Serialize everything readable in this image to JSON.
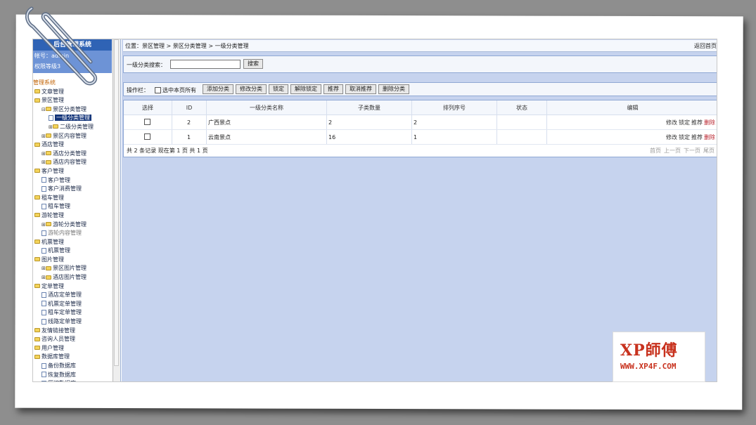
{
  "sidebar": {
    "title": "后台管理系统",
    "account_line": "帐号：admin",
    "level_line": "权限等级3",
    "tree": [
      {
        "label": "管理系统",
        "type": "root"
      },
      {
        "label": "文章管理",
        "type": "folder",
        "indent": 0
      },
      {
        "label": "景区管理",
        "type": "folder",
        "indent": 0
      },
      {
        "label": "景区分类管理",
        "type": "folder",
        "indent": 1,
        "pm": "⊟"
      },
      {
        "label": "一级分类管理",
        "type": "page",
        "indent": 2,
        "selected": true
      },
      {
        "label": "二级分类管理",
        "type": "folder",
        "indent": 2,
        "pm": "⊞"
      },
      {
        "label": "景区内容管理",
        "type": "folder",
        "indent": 1,
        "pm": "⊞"
      },
      {
        "label": "酒店管理",
        "type": "folder",
        "indent": 0
      },
      {
        "label": "酒店分类管理",
        "type": "folder",
        "indent": 1,
        "pm": "⊞"
      },
      {
        "label": "酒店内容管理",
        "type": "folder",
        "indent": 1,
        "pm": "⊞"
      },
      {
        "label": "客户管理",
        "type": "folder",
        "indent": 0
      },
      {
        "label": "客户管理",
        "type": "page",
        "indent": 1
      },
      {
        "label": "客户消费管理",
        "type": "page",
        "indent": 1
      },
      {
        "label": "租车管理",
        "type": "folder",
        "indent": 0
      },
      {
        "label": "租车管理",
        "type": "page",
        "indent": 1
      },
      {
        "label": "游轮管理",
        "type": "folder",
        "indent": 0
      },
      {
        "label": "游轮分类管理",
        "type": "folder",
        "indent": 1,
        "pm": "⊞"
      },
      {
        "label": "游轮内容管理",
        "type": "page",
        "indent": 1,
        "grey": true
      },
      {
        "label": "机票管理",
        "type": "folder",
        "indent": 0
      },
      {
        "label": "机票管理",
        "type": "page",
        "indent": 1
      },
      {
        "label": "图片管理",
        "type": "folder",
        "indent": 0
      },
      {
        "label": "景区图片管理",
        "type": "folder",
        "indent": 1,
        "pm": "⊞"
      },
      {
        "label": "酒店图片管理",
        "type": "folder",
        "indent": 1,
        "pm": "⊞"
      },
      {
        "label": "定单管理",
        "type": "folder",
        "indent": 0
      },
      {
        "label": "酒店定单管理",
        "type": "page",
        "indent": 1
      },
      {
        "label": "机票定单管理",
        "type": "page",
        "indent": 1
      },
      {
        "label": "租车定单管理",
        "type": "page",
        "indent": 1
      },
      {
        "label": "线路定单管理",
        "type": "page",
        "indent": 1
      },
      {
        "label": "友情链接管理",
        "type": "folder",
        "indent": 0
      },
      {
        "label": "咨询人员管理",
        "type": "folder",
        "indent": 0
      },
      {
        "label": "用户管理",
        "type": "folder",
        "indent": 0
      },
      {
        "label": "数据库管理",
        "type": "folder",
        "indent": 0
      },
      {
        "label": "备份数据库",
        "type": "page",
        "indent": 1
      },
      {
        "label": "恢复数据库",
        "type": "page",
        "indent": 1
      },
      {
        "label": "压缩数据库",
        "type": "page",
        "indent": 1
      }
    ]
  },
  "breadcrumb": {
    "text": "位置：景区管理 > 景区分类管理 > 一级分类管理",
    "back_label": "返回首页"
  },
  "search": {
    "label": "一级分类搜索：",
    "value": "",
    "button_label": "搜索"
  },
  "toolbar": {
    "label": "操作栏：",
    "select_all_label": "选中本页所有",
    "buttons": [
      "添加分类",
      "修改分类",
      "锁定",
      "解除锁定",
      "推荐",
      "取消推荐",
      "删除分类"
    ]
  },
  "table": {
    "headers": [
      "选择",
      "ID",
      "一级分类名称",
      "子类数量",
      "排列序号",
      "状态",
      "编辑"
    ],
    "rows": [
      {
        "id": "2",
        "name": "广西景点",
        "children": "2",
        "order": "2",
        "status": ""
      },
      {
        "id": "1",
        "name": "云南景点",
        "children": "16",
        "order": "1",
        "status": ""
      }
    ],
    "row_actions": [
      "修改",
      "锁定",
      "推荐",
      "删除"
    ]
  },
  "footer": {
    "summary": "共 2 条记录  现在第 1 页 共 1 页",
    "pager": [
      "首页",
      "上一页",
      "下一页",
      "尾页"
    ]
  },
  "watermark": {
    "brand": "XP師傅",
    "url": "WWW.XP4F.COM"
  },
  "colors": {
    "sidebar_header": "#2f63b5",
    "content_bg": "#c6d3ee",
    "delete_link": "#b8202a"
  }
}
